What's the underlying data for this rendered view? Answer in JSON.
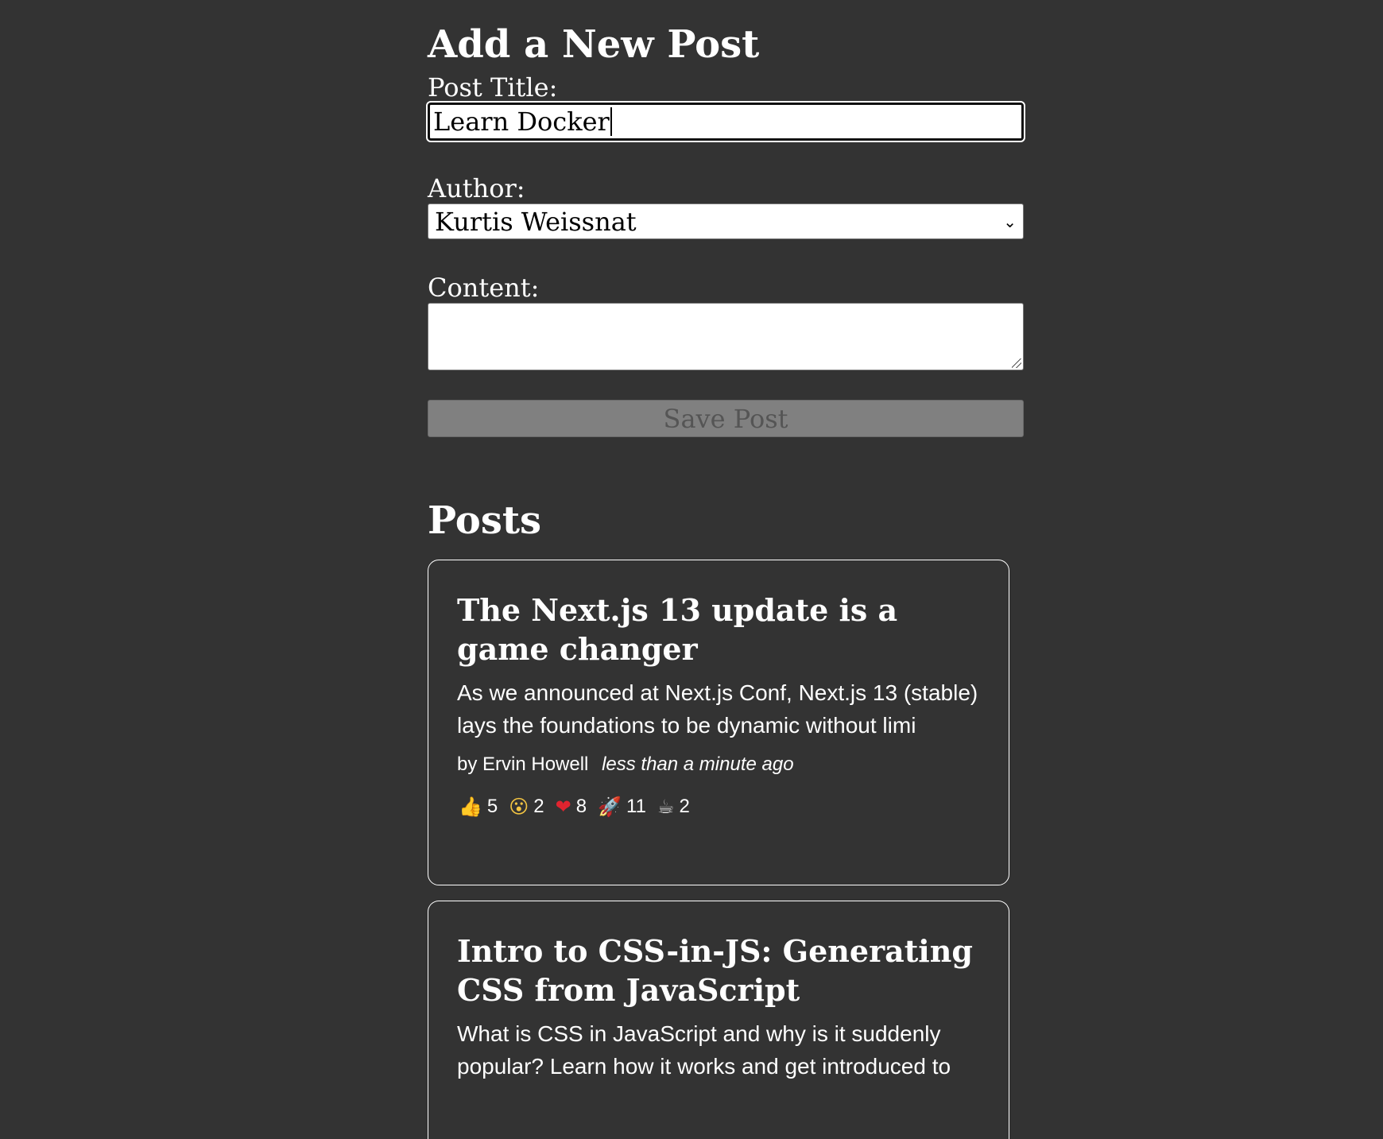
{
  "form": {
    "heading": "Add a New Post",
    "title_label": "Post Title:",
    "title_value": "Learn Docker",
    "author_label": "Author:",
    "author_selected": "Kurtis Weissnat",
    "content_label": "Content:",
    "content_value": "",
    "save_label": "Save Post"
  },
  "posts": {
    "heading": "Posts",
    "items": [
      {
        "title": "The Next.js 13 update is a game changer",
        "excerpt": "As we announced at Next.js Conf, Next.js 13 (stable) lays the foundations to be dynamic without limi",
        "author": "by Ervin Howell",
        "time": "less than a minute ago",
        "reactions": [
          {
            "icon": "thumbs-up-icon",
            "glyph": "👍",
            "count": "5"
          },
          {
            "icon": "wow-icon",
            "glyph": "😮",
            "count": "2"
          },
          {
            "icon": "heart-icon",
            "glyph": "❤",
            "count": "8"
          },
          {
            "icon": "rocket-icon",
            "glyph": "🚀",
            "count": "11"
          },
          {
            "icon": "coffee-icon",
            "glyph": "☕",
            "count": "2"
          }
        ]
      },
      {
        "title": "Intro to CSS-in-JS: Generating CSS from JavaScript",
        "excerpt": "What is CSS in JavaScript and why is it suddenly popular? Learn how it works and get introduced to"
      }
    ]
  }
}
